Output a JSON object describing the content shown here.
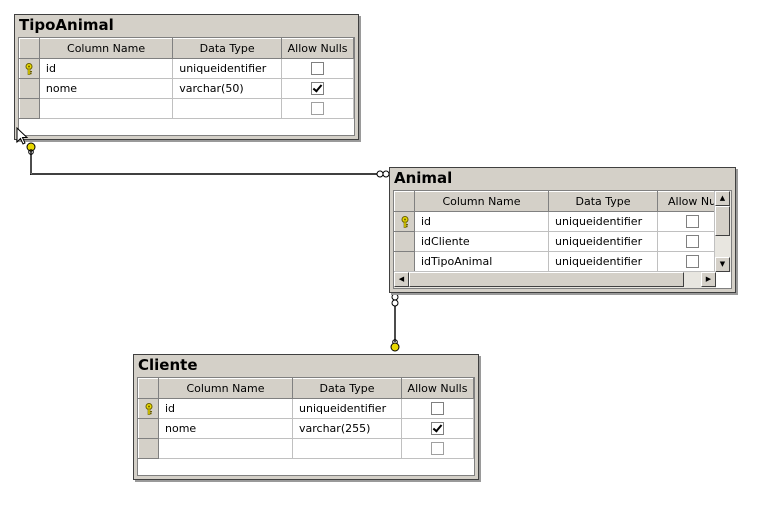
{
  "columns_header": {
    "name": "Column Name",
    "type": "Data Type",
    "nulls": "Allow Nulls",
    "nulls_truncated": "Allow Nulls"
  },
  "tables": {
    "tipoanimal": {
      "title": "TipoAnimal",
      "rows": [
        {
          "name": "id",
          "type": "uniqueidentifier",
          "nulls": false,
          "pk": true
        },
        {
          "name": "nome",
          "type": "varchar(50)",
          "nulls": true,
          "pk": false
        },
        {
          "name": "",
          "type": "",
          "nulls": false,
          "pk": false
        }
      ]
    },
    "animal": {
      "title": "Animal",
      "rows": [
        {
          "name": "id",
          "type": "uniqueidentifier",
          "nulls": false,
          "pk": true
        },
        {
          "name": "idCliente",
          "type": "uniqueidentifier",
          "nulls": false,
          "pk": false
        },
        {
          "name": "idTipoAnimal",
          "type": "uniqueidentifier",
          "nulls": false,
          "pk": false
        }
      ]
    },
    "cliente": {
      "title": "Cliente",
      "rows": [
        {
          "name": "id",
          "type": "uniqueidentifier",
          "nulls": false,
          "pk": true
        },
        {
          "name": "nome",
          "type": "varchar(255)",
          "nulls": true,
          "pk": false
        },
        {
          "name": "",
          "type": "",
          "nulls": false,
          "pk": false
        }
      ]
    }
  },
  "icons": {
    "primary_key": "key-icon",
    "scroll_up": "arrow-up-icon",
    "scroll_down": "arrow-down-icon",
    "scroll_left": "arrow-left-icon",
    "scroll_right": "arrow-right-icon"
  },
  "colors": {
    "window_bg": "#d4d0c8",
    "key": "#e8d800",
    "relationship_line": "#000000"
  }
}
